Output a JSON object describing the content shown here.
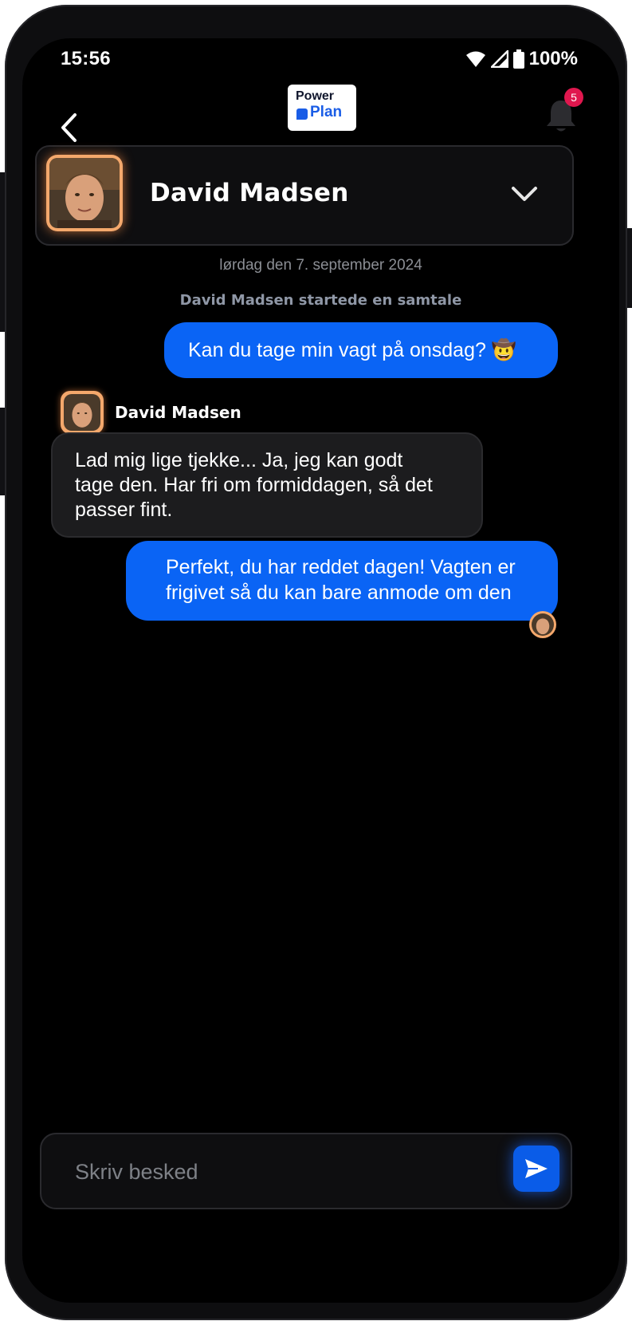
{
  "status_bar": {
    "time": "15:56",
    "battery": "100%"
  },
  "header": {
    "back_icon": "chevron-left-icon",
    "logo_line1": "Power",
    "logo_line2": "Plan",
    "notification_count": "5"
  },
  "contact": {
    "name": "David Madsen"
  },
  "chat": {
    "date": "lørdag den 7. september 2024",
    "system_message": "David Madsen startede en samtale",
    "messages": [
      {
        "direction": "out",
        "lines": [
          "Kan du tage min vagt på onsdag? 🤠"
        ]
      },
      {
        "direction": "in",
        "sender": "David Madsen",
        "lines": [
          "Lad mig lige tjekke... Ja, jeg kan godt",
          "tage den. Har fri om formiddagen, så det",
          "passer fint."
        ]
      },
      {
        "direction": "out",
        "lines": [
          "Perfekt, du har reddet dagen! Vagten er",
          "frigivet så du kan bare anmode om den"
        ]
      }
    ]
  },
  "composer": {
    "placeholder": "Skriv besked"
  },
  "colors": {
    "accent": "#0a64f5",
    "badge": "#e0174e",
    "avatar_ring": "#f4a86c",
    "background": "#000000"
  }
}
